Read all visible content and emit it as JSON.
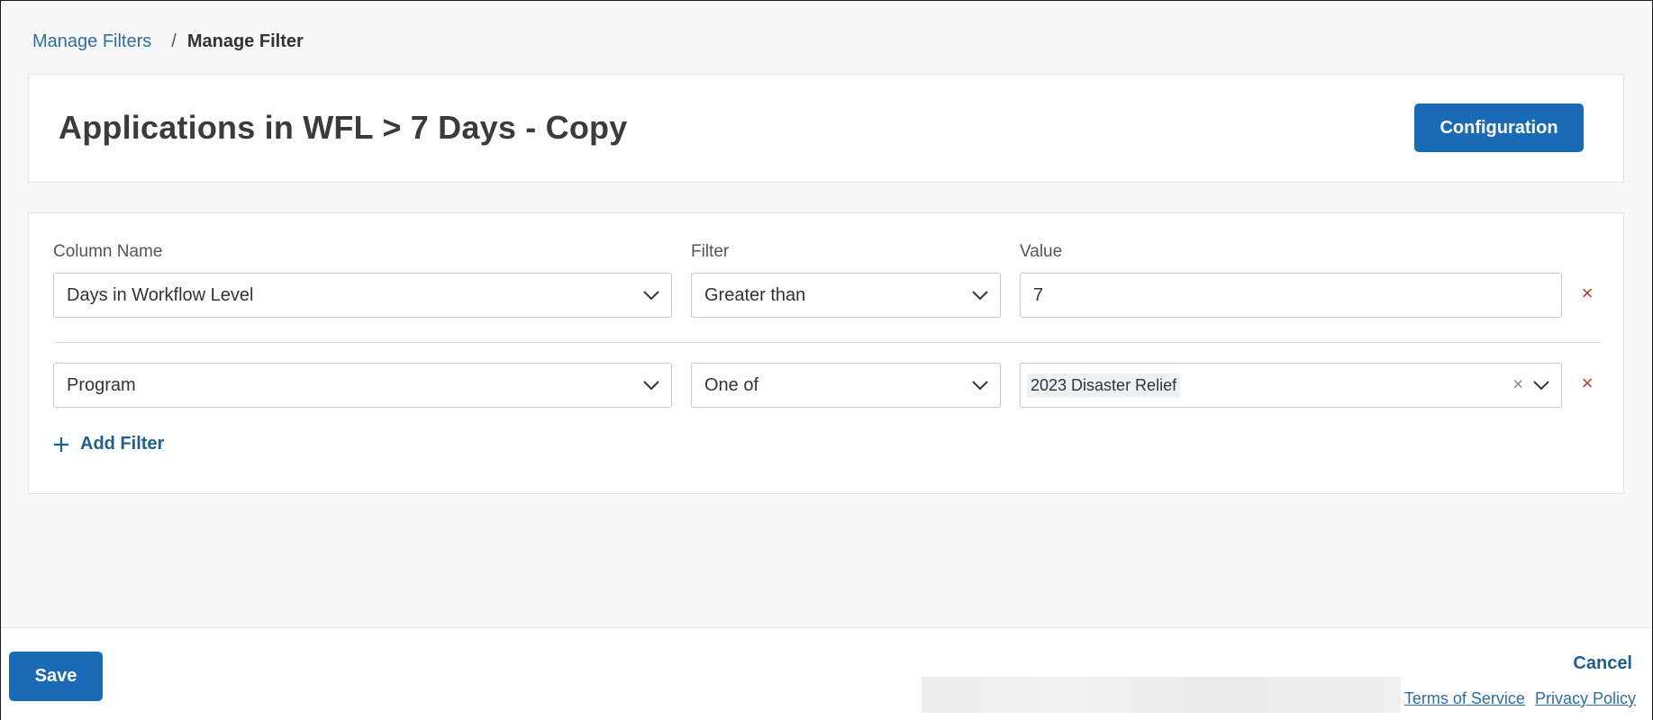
{
  "breadcrumb": {
    "parent": "Manage Filters",
    "separator": "/",
    "current": "Manage Filter"
  },
  "header": {
    "title": "Applications in WFL > 7 Days - Copy",
    "config_label": "Configuration"
  },
  "filters": {
    "column_label": "Column Name",
    "filter_label": "Filter",
    "value_label": "Value",
    "rows": [
      {
        "column": "Days in Workflow Level",
        "operator": "Greater than",
        "value": "7"
      },
      {
        "column": "Program",
        "operator": "One of",
        "value_chip": "2023 Disaster Relief"
      }
    ],
    "add_label": "Add Filter",
    "remove_glyph": "×",
    "clear_glyph": "×"
  },
  "footer": {
    "save_label": "Save",
    "cancel_label": "Cancel",
    "terms_label": "Terms of Service",
    "privacy_label": "Privacy Policy"
  },
  "icons": {
    "chevron": "chevron-down-icon",
    "remove": "close-icon",
    "add": "plus-icon"
  },
  "colors": {
    "primary": "#1b6ab5",
    "link": "#2e6f9e",
    "danger": "#c0392b"
  }
}
